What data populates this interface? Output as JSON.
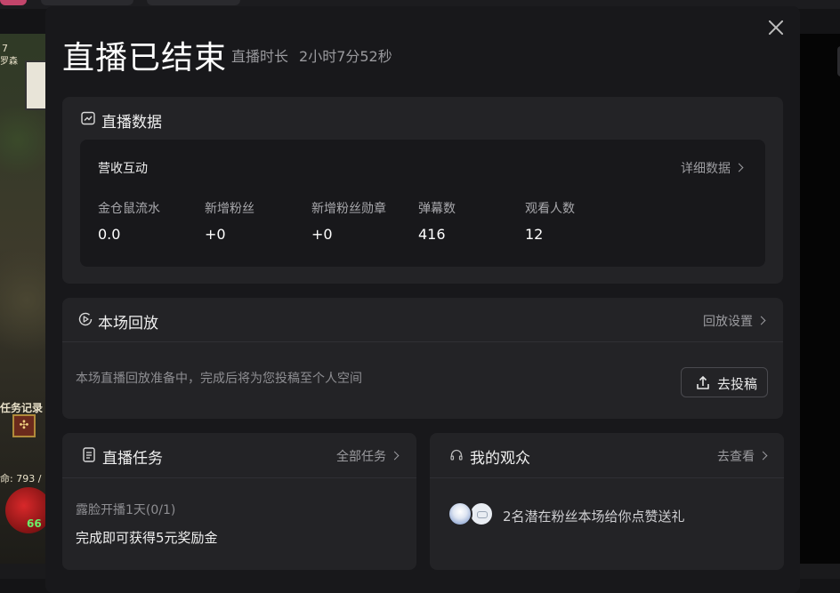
{
  "background": {
    "game_labels": {
      "top_small": "7",
      "name": "罗森",
      "task_log": "任务记录",
      "life": "命: 793 /",
      "orb_value": "66"
    }
  },
  "modal": {
    "title": "直播已结束",
    "duration_label": "直播时长",
    "duration_value": "2小时7分52秒",
    "stats": {
      "header": "直播数据",
      "section_title": "营收互动",
      "detail_link": "详细数据",
      "items": [
        {
          "label": "金仓鼠流水",
          "value": "0.0"
        },
        {
          "label": "新增粉丝",
          "value": "+0"
        },
        {
          "label": "新增粉丝勋章",
          "value": "+0"
        },
        {
          "label": "弹幕数",
          "value": "416"
        },
        {
          "label": "观看人数",
          "value": "12"
        }
      ]
    },
    "replay": {
      "header": "本场回放",
      "settings_link": "回放设置",
      "description": "本场直播回放准备中，完成后将为您投稿至个人空间",
      "upload_button": "去投稿"
    },
    "tasks": {
      "header": "直播任务",
      "all_link": "全部任务",
      "task_name": "露脸开播1天(0/1)",
      "task_reward": "完成即可获得5元奖励金"
    },
    "audience": {
      "header": "我的观众",
      "view_link": "去查看",
      "summary": "2名潜在粉丝本场给你点赞送礼"
    }
  },
  "icons": {
    "close": "close-icon",
    "stats": "line-chart-icon",
    "replay": "play-circle-icon",
    "upload": "upload-icon",
    "tasks": "document-icon",
    "audience": "headset-icon"
  },
  "colors": {
    "modal_bg": "#18181b",
    "card_bg": "#232326",
    "text_primary": "#ffffff",
    "text_secondary": "#9c9ca0"
  }
}
